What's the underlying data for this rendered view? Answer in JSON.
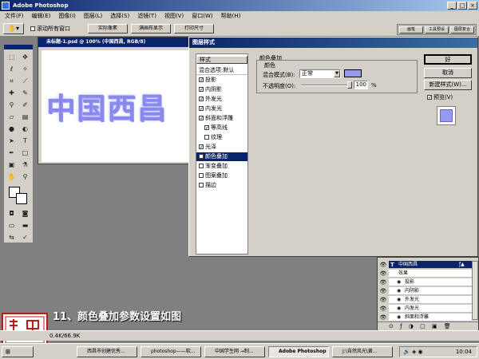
{
  "window": {
    "title": "Adobe Photoshop"
  },
  "menu": [
    "文件(F)",
    "编辑(E)",
    "图像(I)",
    "图层(L)",
    "选择(S)",
    "滤镜(T)",
    "视图(V)",
    "窗口(W)",
    "帮助(H)"
  ],
  "options": {
    "scroll_all_label": "滚动所有窗口",
    "actual_pixels": "实际像素",
    "fit_screen": "满画布显示",
    "print_size": "打印尺寸"
  },
  "palette_tabs": [
    "画笔",
    "工具预设",
    "图层复合"
  ],
  "document": {
    "title": "未标题-1.psd @ 100% (中国西昌, RGB/8)",
    "artwork_text": "中国西昌"
  },
  "dialog": {
    "title": "图层样式",
    "styles_header": "样式",
    "blend_default": "混合选项:默认",
    "items": [
      {
        "label": "投影",
        "checked": true
      },
      {
        "label": "内阴影",
        "checked": true
      },
      {
        "label": "外发光",
        "checked": true
      },
      {
        "label": "内发光",
        "checked": true
      },
      {
        "label": "斜面和浮雕",
        "checked": true
      },
      {
        "label": "等高线",
        "checked": true,
        "sub": true
      },
      {
        "label": "纹理",
        "checked": false,
        "sub": true
      },
      {
        "label": "光泽",
        "checked": true
      },
      {
        "label": "颜色叠加",
        "checked": true,
        "selected": true
      },
      {
        "label": "渐变叠加",
        "checked": false
      },
      {
        "label": "图案叠加",
        "checked": false
      },
      {
        "label": "描边",
        "checked": false
      }
    ],
    "section_title": "颜色叠加",
    "section_sub": "颜色",
    "blend_mode_label": "混合模式(B):",
    "blend_mode_value": "正常",
    "opacity_label": "不透明度(O):",
    "opacity_value": "100",
    "opacity_unit": "%",
    "overlay_color": "#9999ee",
    "ok": "好",
    "cancel": "取消",
    "new_style": "新建样式(W)...",
    "preview": "预览(V)"
  },
  "layers": {
    "layer_name": "中国西昌",
    "effects_label": "效果",
    "effects": [
      "投影",
      "内阴影",
      "外发光",
      "内发光",
      "斜面和浮雕"
    ]
  },
  "caption": "11、颜色叠加参数设置如图",
  "status": {
    "doc_size": "0.4K/66.9K"
  },
  "taskbar": {
    "tasks": [
      "西昌市创建优秀...",
      "photoshop——软...",
      "中国学生网 →制...",
      "Adobe Photoshop",
      "J:\\自然风光\\黄..."
    ],
    "clock": "10:04"
  }
}
